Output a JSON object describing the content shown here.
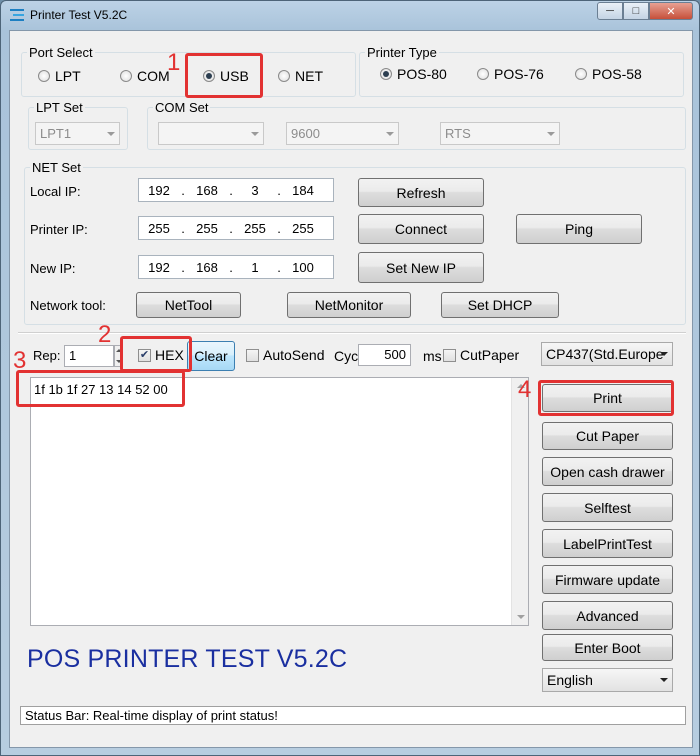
{
  "window": {
    "title": "Printer Test V5.2C",
    "controls": {
      "minimize": "─",
      "maximize": "□",
      "close": "✕"
    }
  },
  "port_select": {
    "legend": "Port Select",
    "options": [
      "LPT",
      "COM",
      "USB",
      "NET"
    ],
    "selected": "USB"
  },
  "printer_type": {
    "legend": "Printer Type",
    "options": [
      "POS-80",
      "POS-76",
      "POS-58"
    ],
    "selected": "POS-80"
  },
  "lpt_set": {
    "legend": "LPT Set",
    "value": "LPT1"
  },
  "com_set": {
    "legend": "COM Set",
    "port": "",
    "baud": "9600",
    "flow": "RTS"
  },
  "net_set": {
    "legend": "NET Set",
    "local_ip_label": "Local IP:",
    "local_ip": [
      "192",
      "168",
      "3",
      "184"
    ],
    "printer_ip_label": "Printer IP:",
    "printer_ip": [
      "255",
      "255",
      "255",
      "255"
    ],
    "new_ip_label": "New IP:",
    "new_ip": [
      "192",
      "168",
      "1",
      "100"
    ],
    "refresh_label": "Refresh",
    "connect_label": "Connect",
    "ping_label": "Ping",
    "set_new_ip_label": "Set New IP",
    "network_tool_label": "Network tool:",
    "nettool_label": "NetTool",
    "netmonitor_label": "NetMonitor",
    "setdhcp_label": "Set DHCP"
  },
  "send_bar": {
    "rep_label": "Rep:",
    "rep_value": "1",
    "hex_label": "HEX",
    "hex_checked": true,
    "clear_label": "Clear",
    "autosend_label": "AutoSend",
    "autosend_checked": false,
    "cyc_label": "Cyc",
    "cyc_value": "500",
    "ms_label": "ms",
    "cutpaper_label": "CutPaper",
    "cutpaper_checked": false,
    "codepage": "CP437(Std.Europe"
  },
  "editor": {
    "content": "1f 1b 1f 27 13 14 52 00"
  },
  "actions": {
    "print": "Print",
    "cut_paper": "Cut Paper",
    "open_cash_drawer": "Open cash drawer",
    "selftest": "Selftest",
    "label_print_test": "LabelPrintTest",
    "firmware_update": "Firmware update",
    "advanced": "Advanced",
    "enter_boot": "Enter Boot",
    "language": "English"
  },
  "banner": "POS PRINTER TEST V5.2C",
  "status_bar": "Status Bar: Real-time display of print status!",
  "annotations": {
    "step1": "1",
    "step2": "2",
    "step3": "3",
    "step4": "4",
    "color": "#e23232"
  }
}
